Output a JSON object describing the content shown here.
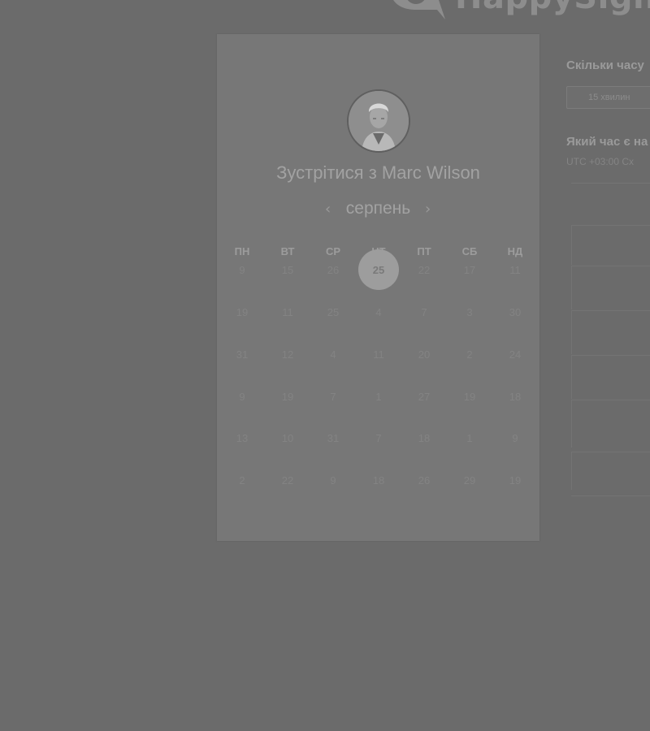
{
  "brand": {
    "name": "HappySign"
  },
  "meeting": {
    "title": "Зустрітися з Marc Wilson",
    "month": "серпень",
    "prev_icon": "chevron-left-icon",
    "next_icon": "chevron-right-icon"
  },
  "calendar": {
    "weekdays": [
      "ПН",
      "ВТ",
      "СР",
      "ЧТ",
      "ПТ",
      "СБ",
      "НД"
    ],
    "weeks": [
      [
        "9",
        "15",
        "26",
        "25",
        "22",
        "17",
        "11"
      ],
      [
        "19",
        "11",
        "25",
        "4",
        "7",
        "3",
        "30"
      ],
      [
        "31",
        "12",
        "4",
        "11",
        "20",
        "2",
        "24"
      ],
      [
        "9",
        "19",
        "7",
        "1",
        "27",
        "19",
        "18"
      ],
      [
        "13",
        "10",
        "31",
        "7",
        "18",
        "1",
        "9"
      ],
      [
        "2",
        "22",
        "9",
        "18",
        "26",
        "29",
        "19"
      ]
    ],
    "selected": "25"
  },
  "side": {
    "duration_question": "Скільки часу",
    "duration_value": "15 хвилин",
    "time_question": "Який час є на",
    "timezone": "UTC +03:00 Сх"
  },
  "colors": {
    "background": "#6b6b6b",
    "card": "#777777",
    "selected_day": "#9d9d9d"
  }
}
